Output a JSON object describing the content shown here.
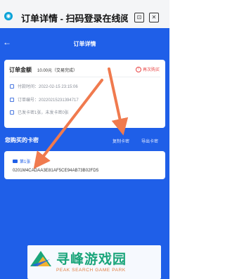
{
  "miniprogram": {
    "logo": "◉",
    "title": "订单详情 - 扫码登录在线阅"
  },
  "header": {
    "back_icon": "←",
    "title": "订单详情"
  },
  "order": {
    "amount_label": "订单金额",
    "amount_value": "10.00元（交易完成）",
    "rebuy_label": "再次购买",
    "pay_time": "付款时间：2022-02-15 23:15:06",
    "order_no": "订单编号：20220215231394717",
    "delivery": "已发卡密1张，未发卡密0张"
  },
  "codes": {
    "section_title": "您购买的卡密",
    "copy_label": "复制卡密",
    "export_label": "导出卡密",
    "item_label": "第1张",
    "item_code": "0201M4CADAA3E81AF5CE94AB73B02FD5"
  },
  "watermark": {
    "brand": "寻峰游戏园",
    "sub": "PEAK SEARCH GAME PARK"
  },
  "colors": {
    "primary_blue": "#1f5fe8",
    "alert_red": "#e84545",
    "arrow_orange": "#f07a4e",
    "brand_green": "#1aa57a"
  }
}
